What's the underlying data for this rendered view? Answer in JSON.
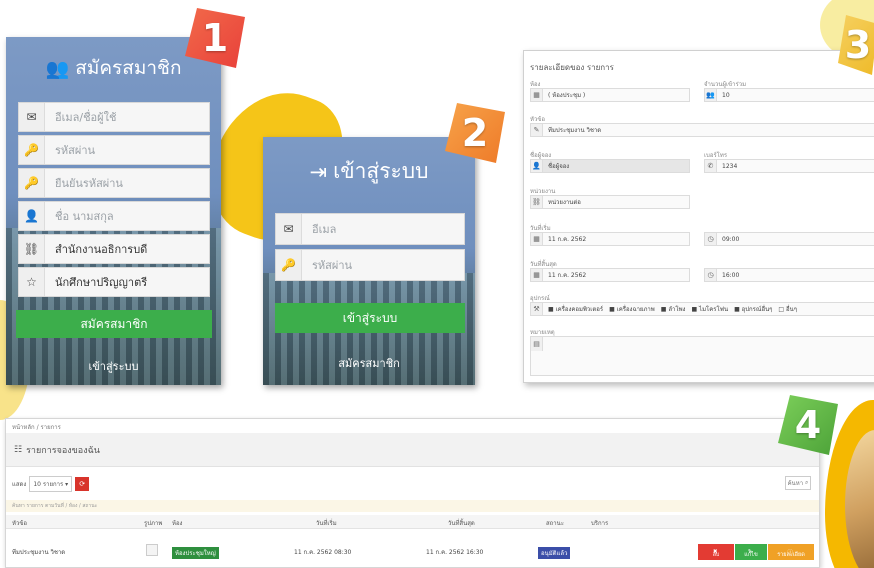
{
  "badges": [
    "1",
    "2",
    "3",
    "4"
  ],
  "register": {
    "title": "สมัครสมาชิก",
    "fields": [
      {
        "icon": "envelope-icon",
        "glyph": "✉",
        "value": "อีเมล/ชื่อผู้ใช้",
        "filled": false
      },
      {
        "icon": "key-icon",
        "glyph": "🔑",
        "value": "รหัสผ่าน",
        "filled": false
      },
      {
        "icon": "key-icon",
        "glyph": "🔑",
        "value": "ยืนยันรหัสผ่าน",
        "filled": false
      },
      {
        "icon": "user-icon",
        "glyph": "👤",
        "value": "ชื่อ นามสกุล",
        "filled": false
      },
      {
        "icon": "sitemap-icon",
        "glyph": "⛓",
        "value": "สำนักงานอธิการบดี",
        "filled": true
      },
      {
        "icon": "star-icon",
        "glyph": "☆",
        "value": "นักศึกษาปริญญาตรี",
        "filled": true
      }
    ],
    "submit_label": "สมัครสมาชิก",
    "login_link": "เข้าสู่ระบบ"
  },
  "login": {
    "title": "เข้าสู่ระบบ",
    "email_placeholder": "อีเมล",
    "password_placeholder": "รหัสผ่าน",
    "submit_label": "เข้าสู่ระบบ",
    "register_link": "สมัครสมาชิก"
  },
  "booking_form": {
    "title": "รายละเอียดของ รายการ",
    "fields": [
      {
        "label": "ห้อง",
        "value": "( ห้องประชุม )"
      },
      {
        "label": "จำนวนผู้เข้าร่วม",
        "value": "10"
      },
      {
        "label": "หัวข้อ",
        "value": "ทีมประชุมงาน วิชาด"
      },
      {
        "label": "ชื่อผู้จอง",
        "value": "ชื่อผู้จอง"
      },
      {
        "label": "เบอร์โทร",
        "value": "1234"
      },
      {
        "label": "หน่วยงาน",
        "value": "หน่วยงานต่อ"
      },
      {
        "label": "วันที่เริ่ม",
        "value": "11 ก.ค. 2562"
      },
      {
        "label": "เวลาเริ่ม",
        "value": "09:00"
      },
      {
        "label": "วันที่สิ้นสุด",
        "value": "11 ก.ค. 2562"
      },
      {
        "label": "เวลาสิ้นสุด",
        "value": "16:00"
      }
    ],
    "equipment_label": "อุปกรณ์",
    "equipment": [
      "เครื่องคอมพิวเตอร์",
      "เครื่องฉายภาพ",
      "ลำโพง",
      "ไมโครโฟน",
      "อุปกรณ์อื่นๆ",
      "อื่นๆ"
    ],
    "note_label": "หมายเหตุ"
  },
  "booking_table": {
    "breadcrumb": "หน้าหลัก / รายการ",
    "heading": "รายการจองของฉัน",
    "per_page": "10 รายการ",
    "search": "ค้นหา",
    "hint": "ค้นหา รายการ ตามวันที่ / ห้อง / สถานะ",
    "columns": [
      "หัวข้อ",
      "รูปภาพ",
      "ห้อง",
      "วันที่เริ่ม",
      "วันที่สิ้นสุด",
      "สถานะ",
      "บริการ"
    ],
    "row": {
      "title": "ทีมประชุมงาน วิชาด",
      "room": "ห้องประชุมใหญ่",
      "start": "11 ก.ค. 2562 08:30",
      "end": "11 ก.ค. 2562 16:30",
      "status": "อนุมัติแล้ว"
    },
    "actions": {
      "delete": "ลบ",
      "edit": "แก้ไข",
      "view": "รายละเอียด"
    }
  },
  "colors": {
    "green": "#3cae4b",
    "red": "#e33b33",
    "blue": "#3b4ea8",
    "orange": "#f0a126"
  }
}
